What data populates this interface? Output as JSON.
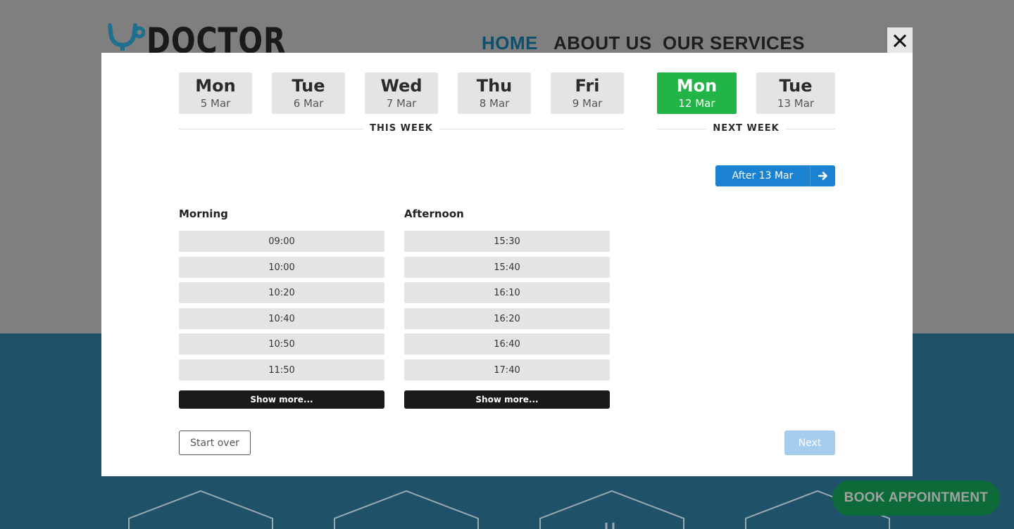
{
  "header": {
    "logo_text": "DOCTOR",
    "nav": [
      "HOME",
      "ABOUT US",
      "OUR SERVICES"
    ]
  },
  "floating": {
    "book_label": "BOOK APPOINTMENT"
  },
  "modal": {
    "days": [
      {
        "name": "Mon",
        "date": "5 Mar",
        "selected": false
      },
      {
        "name": "Tue",
        "date": "6 Mar",
        "selected": false
      },
      {
        "name": "Wed",
        "date": "7 Mar",
        "selected": false
      },
      {
        "name": "Thu",
        "date": "8 Mar",
        "selected": false
      },
      {
        "name": "Fri",
        "date": "9 Mar",
        "selected": false
      },
      {
        "name": "Mon",
        "date": "12 Mar",
        "selected": true
      },
      {
        "name": "Tue",
        "date": "13 Mar",
        "selected": false
      }
    ],
    "this_week_label": "THIS WEEK",
    "next_week_label": "NEXT WEEK",
    "after_label": "After 13 Mar",
    "morning": {
      "title": "Morning",
      "slots": [
        "09:00",
        "10:00",
        "10:20",
        "10:40",
        "10:50",
        "11:50"
      ],
      "more_label": "Show more..."
    },
    "afternoon": {
      "title": "Afternoon",
      "slots": [
        "15:30",
        "15:40",
        "16:10",
        "16:20",
        "16:40",
        "17:40"
      ],
      "more_label": "Show more..."
    },
    "start_over_label": "Start over",
    "next_label": "Next"
  },
  "colors": {
    "selected_day": "#22b447",
    "primary_blue": "#1b82d2",
    "next_disabled": "#a7cdee"
  },
  "icons": [
    "stethoscope-icon",
    "close-icon",
    "arrow-right-icon",
    "hexagon-icon"
  ]
}
